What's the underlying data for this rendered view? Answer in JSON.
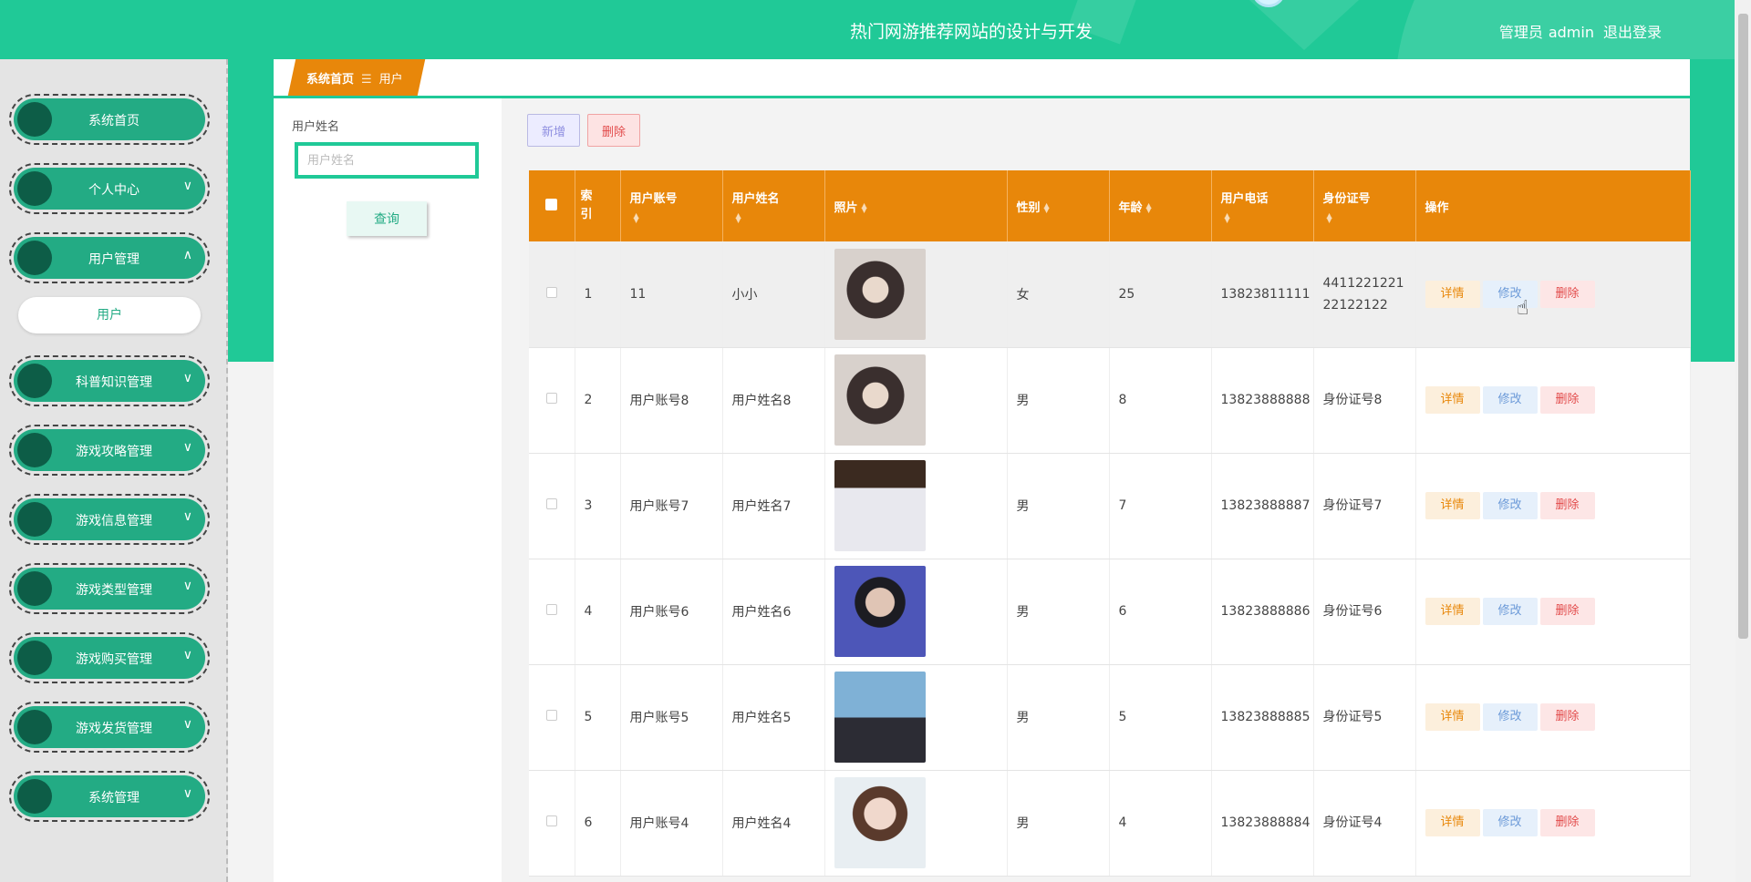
{
  "header": {
    "title": "热门网游推荐网站的设计与开发",
    "role": "管理员",
    "username": "admin",
    "logout": "退出登录"
  },
  "sidebar": {
    "items": [
      {
        "label": "系统首页",
        "arrow": ""
      },
      {
        "label": "个人中心",
        "arrow": "∨"
      },
      {
        "label": "用户管理",
        "arrow": "∧"
      },
      {
        "label": "科普知识管理",
        "arrow": "∨"
      },
      {
        "label": "游戏攻略管理",
        "arrow": "∨"
      },
      {
        "label": "游戏信息管理",
        "arrow": "∨"
      },
      {
        "label": "游戏类型管理",
        "arrow": "∨"
      },
      {
        "label": "游戏购买管理",
        "arrow": "∨"
      },
      {
        "label": "游戏发货管理",
        "arrow": "∨"
      },
      {
        "label": "系统管理",
        "arrow": "∨"
      }
    ],
    "sub_item": "用户"
  },
  "breadcrumb": {
    "home": "系统首页",
    "separator": "☰",
    "current": "用户"
  },
  "search": {
    "label": "用户姓名",
    "placeholder": "用户姓名",
    "button": "查询"
  },
  "toolbar": {
    "add": "新增",
    "delete": "删除"
  },
  "table": {
    "headers": {
      "index": "索引",
      "account": "用户账号",
      "name": "用户姓名",
      "photo": "照片",
      "gender": "性别",
      "age": "年龄",
      "phone": "用户电话",
      "idcard": "身份证号",
      "actions": "操作"
    },
    "actions": {
      "detail": "详情",
      "edit": "修改",
      "delete": "删除"
    },
    "rows": [
      {
        "index": "1",
        "account": "11",
        "name": "小小",
        "gender": "女",
        "age": "25",
        "phone": "13823811111",
        "idcard": "441122122122122122"
      },
      {
        "index": "2",
        "account": "用户账号8",
        "name": "用户姓名8",
        "gender": "男",
        "age": "8",
        "phone": "13823888888",
        "idcard": "身份证号8"
      },
      {
        "index": "3",
        "account": "用户账号7",
        "name": "用户姓名7",
        "gender": "男",
        "age": "7",
        "phone": "13823888887",
        "idcard": "身份证号7"
      },
      {
        "index": "4",
        "account": "用户账号6",
        "name": "用户姓名6",
        "gender": "男",
        "age": "6",
        "phone": "13823888886",
        "idcard": "身份证号6"
      },
      {
        "index": "5",
        "account": "用户账号5",
        "name": "用户姓名5",
        "gender": "男",
        "age": "5",
        "phone": "13823888885",
        "idcard": "身份证号5"
      },
      {
        "index": "6",
        "account": "用户账号4",
        "name": "用户姓名4",
        "gender": "男",
        "age": "4",
        "phone": "13823888884",
        "idcard": "身份证号4"
      }
    ]
  },
  "colors": {
    "primary": "#20c997",
    "nav": "#23ab84",
    "accent": "#e8870a",
    "danger": "#e24b4b"
  }
}
